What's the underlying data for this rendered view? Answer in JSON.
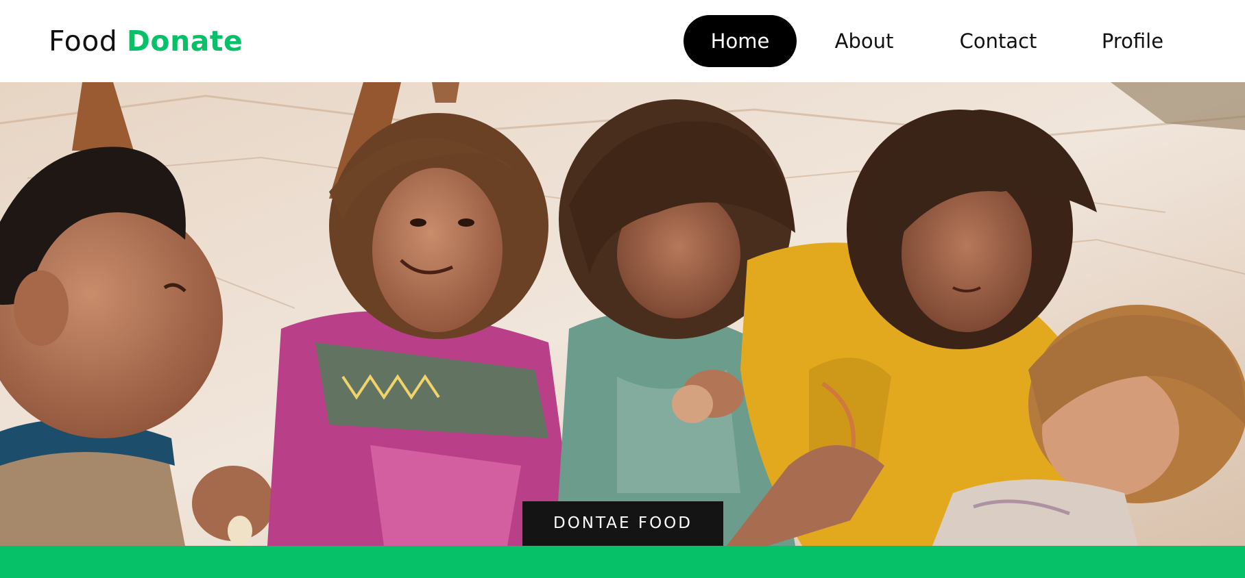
{
  "navbar": {
    "logo_word1": "Food",
    "logo_word2": "Donate",
    "links": [
      {
        "label": "Home",
        "active": true
      },
      {
        "label": "About",
        "active": false
      },
      {
        "label": "Contact",
        "active": false
      },
      {
        "label": "Profile",
        "active": false
      }
    ]
  },
  "hero": {
    "image": "children-eating-photo",
    "cta_label": "DONTAE FOOD"
  },
  "colors": {
    "brand_green": "#06c167",
    "nav_active_bg": "#000000",
    "cta_bg": "#141414",
    "text_dark": "#111111"
  }
}
